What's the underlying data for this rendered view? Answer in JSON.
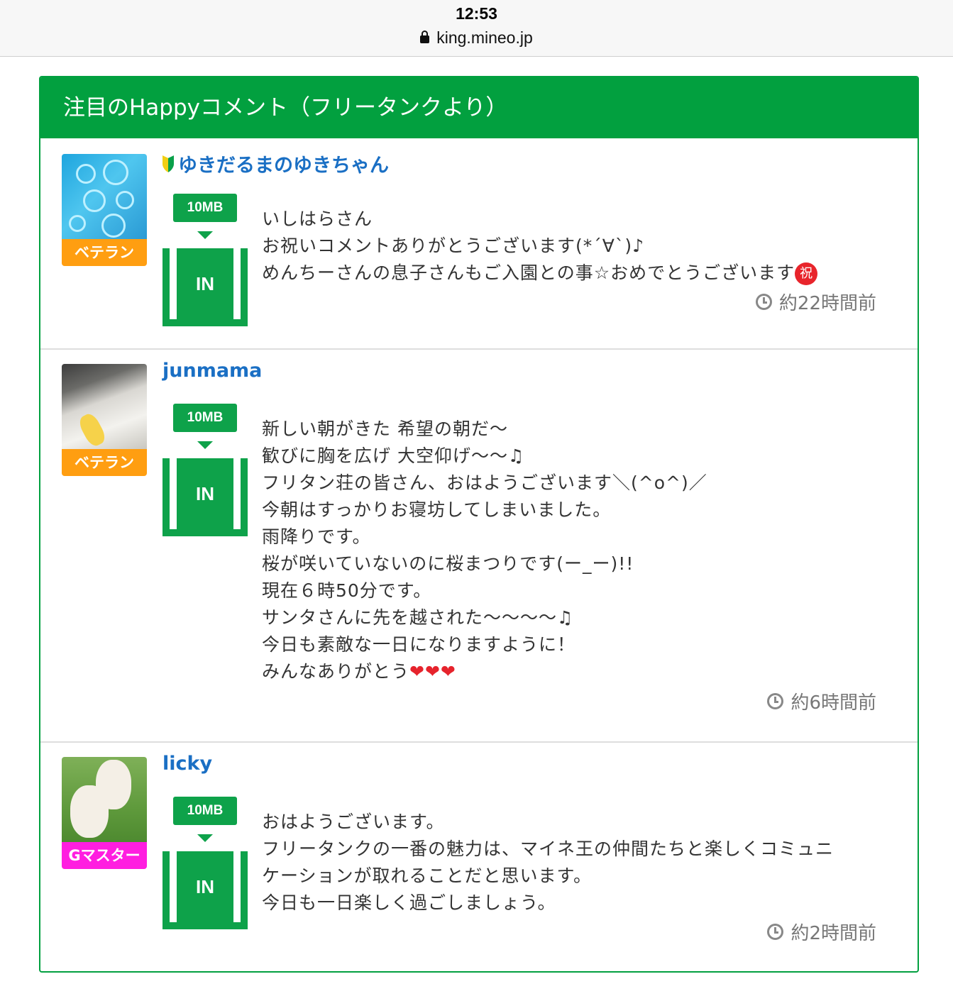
{
  "browser": {
    "time": "12:53",
    "url": "king.mineo.jp"
  },
  "card": {
    "title": "注目のHappyコメント（フリータンクより）"
  },
  "comments": [
    {
      "username": "ゆきだるまのゆきちゃん",
      "beginner_icon": "beginner-mark-icon",
      "rank": "ベテラン",
      "badge_amount": "10MB",
      "badge_label": "IN",
      "lines": [
        "いしはらさん",
        "お祝いコメントありがとうございます(*´∀`)♪",
        "めんちーさんの息子さんもご入園との事☆おめでとうございます"
      ],
      "emoji_end": "祝",
      "time_ago": "約22時間前"
    },
    {
      "username": "junmama",
      "rank": "ベテラン",
      "badge_amount": "10MB",
      "badge_label": "IN",
      "lines": [
        "新しい朝がきた 希望の朝だ〜",
        "歓びに胸を広げ 大空仰げ〜〜♫",
        "フリタン荘の皆さん、おはようございます＼(^o^)／",
        "今朝はすっかりお寝坊してしまいました。",
        "雨降りです。",
        "桜が咲いていないのに桜まつりです(ー_ー)!!",
        "現在６時50分です。",
        "サンタさんに先を越された〜〜〜〜♫",
        "今日も素敵な一日になりますように！",
        "みんなありがとう"
      ],
      "hearts": "❤❤❤",
      "time_ago": "約6時間前"
    },
    {
      "username": "licky",
      "rank": "Gマスター",
      "badge_amount": "10MB",
      "badge_label": "IN",
      "lines": [
        "おはようございます。",
        "フリータンクの一番の魅力は、マイネ王の仲間たちと楽しくコミュニ",
        "ケーションが取れることだと思います。",
        "今日も一日楽しく過ごしましょう。"
      ],
      "time_ago": "約2時間前"
    }
  ],
  "colors": {
    "brand_green": "#02a03f",
    "username_blue": "#1a6fc4",
    "rank_veteran": "#ff9e11",
    "rank_gmaster": "#ff1ee0"
  }
}
